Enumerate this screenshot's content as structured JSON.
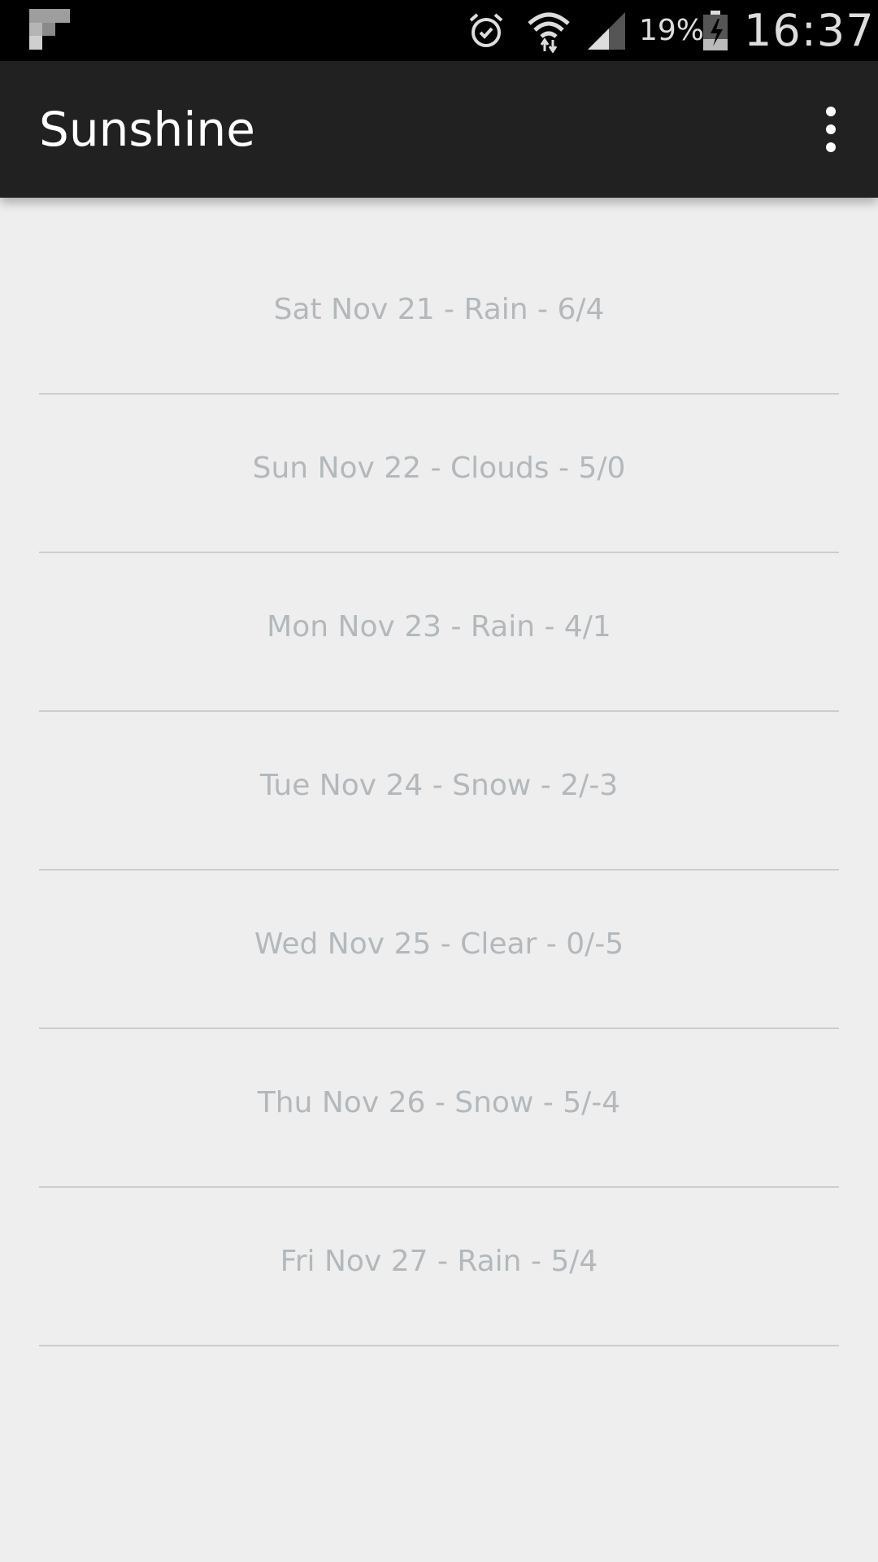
{
  "status_bar": {
    "notification_icon": "flipboard-icon",
    "icons": [
      "alarm-icon",
      "wifi-icon",
      "cell-signal-icon",
      "battery-charging-icon"
    ],
    "battery_percent": "19%",
    "clock": "16:37"
  },
  "app_bar": {
    "title": "Sunshine",
    "overflow_icon": "more-vert-icon"
  },
  "forecast": [
    {
      "text": "Sat Nov 21 - Rain - 6/4"
    },
    {
      "text": "Sun Nov 22 - Clouds - 5/0"
    },
    {
      "text": "Mon Nov 23 - Rain - 4/1"
    },
    {
      "text": "Tue Nov 24 - Snow - 2/-3"
    },
    {
      "text": "Wed Nov 25 - Clear - 0/-5"
    },
    {
      "text": "Thu Nov 26 - Snow - 5/-4"
    },
    {
      "text": "Fri Nov 27 - Rain - 5/4"
    }
  ],
  "colors": {
    "status_bar": "#000000",
    "app_bar": "#212121",
    "background": "#eeeeee",
    "forecast_text": "#b3b8bc",
    "divider": "#cdcdcd"
  }
}
